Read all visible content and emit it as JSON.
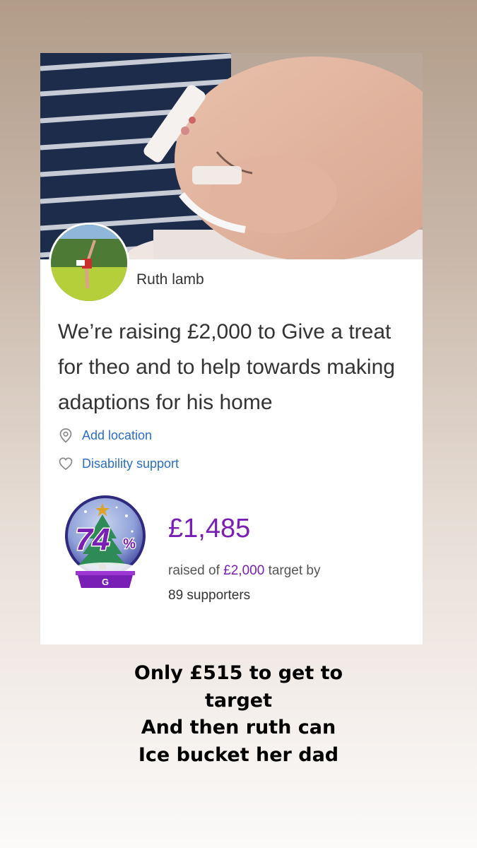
{
  "fundraiser": {
    "organiser_name": "Ruth lamb",
    "headline": "We’re raising £2,000 to Give a treat for theo and to help towards making adaptions for his home",
    "location_link": "Add location",
    "category_link": "Disability support",
    "progress": {
      "percent": 74,
      "percent_number": "74",
      "percent_sign": "%",
      "badge_letter": "G"
    },
    "amount_raised": "£1,485",
    "raised_prefix": "raised of",
    "target_amount": "£2,000",
    "raised_suffix": "target by",
    "supporters": "89 supporters"
  },
  "caption": {
    "lines": [
      "Only  £515 to get to",
      "target",
      "And then ruth can",
      "Ice bucket her dad"
    ]
  },
  "colors": {
    "accent_purple": "#7a1fb5",
    "link_blue": "#2a6ec6",
    "text_dark": "#333333"
  },
  "icons": [
    "location-pin-icon",
    "heart-icon",
    "christmas-tree-icon",
    "star-icon"
  ]
}
